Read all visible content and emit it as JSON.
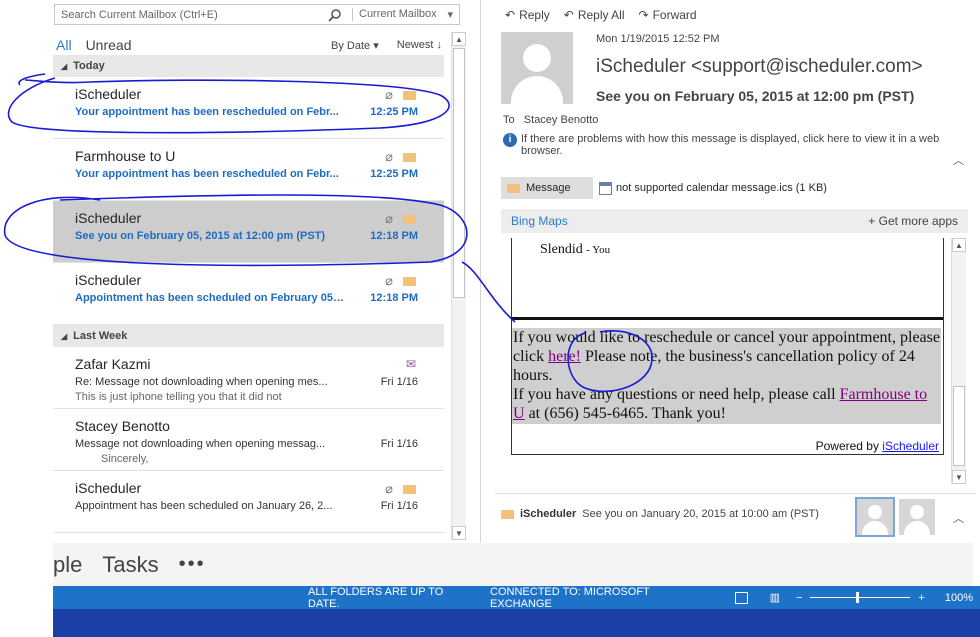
{
  "search": {
    "placeholder": "Search Current Mailbox (Ctrl+E)",
    "scope": "Current Mailbox"
  },
  "filters": {
    "all": "All",
    "unread": "Unread",
    "sort_by": "By Date",
    "order": "Newest"
  },
  "groups": [
    {
      "label": "Today"
    },
    {
      "label": "Last Week"
    }
  ],
  "messages": [
    {
      "from": "iScheduler",
      "subject": "Your appointment has been rescheduled on Febr...",
      "time": "12:25 PM",
      "preview": "",
      "unread": true
    },
    {
      "from": "Farmhouse to U",
      "subject": "Your appointment has been rescheduled on Febr...",
      "time": "12:25 PM",
      "preview": "",
      "unread": true
    },
    {
      "from": "iScheduler",
      "subject": "See you on February 05, 2015  at 12:00 pm (PST)",
      "time": "12:18 PM",
      "preview": "",
      "unread": true
    },
    {
      "from": "iScheduler",
      "subject": "Appointment has been scheduled on February 05,...",
      "time": "12:18 PM",
      "preview": "",
      "unread": true
    },
    {
      "from": "Zafar Kazmi",
      "subject": "Re: Message not downloading when opening mes...",
      "time": "Fri 1/16",
      "preview": "This is just iphone telling you that it did not",
      "unread": false
    },
    {
      "from": "Stacey Benotto",
      "subject": "Message not downloading when opening messag...",
      "time": "Fri 1/16",
      "preview": "Sincerely,",
      "unread": false
    },
    {
      "from": "iScheduler",
      "subject": "Appointment has been scheduled on January 26, 2...",
      "time": "Fri 1/16",
      "preview": "",
      "unread": false
    }
  ],
  "reading": {
    "actions": {
      "reply": "Reply",
      "reply_all": "Reply All",
      "forward": "Forward"
    },
    "date": "Mon 1/19/2015 12:52 PM",
    "from": "iScheduler <support@ischeduler.com>",
    "subject": "See you on February 05, 2015  at 12:00 pm (PST)",
    "to_label": "To",
    "to": "Stacey Benotto",
    "info": "If there are problems with how this message is displayed, click here to view it in a web browser.",
    "message_tab": "Message",
    "attachment": "not supported calendar message.ics (1 KB)",
    "bing_maps": "Bing Maps",
    "get_more_apps": "Get more apps",
    "body": {
      "slendid": "Slendid",
      "slendid_suffix": "- You",
      "para1_a": "If you would like to reschedule or cancel your appointment, please click ",
      "para1_link": "here!",
      "para1_b": " Please note, the business's cancellation policy of 24 hours.",
      "para2_a": "If you have any questions or need help, please call ",
      "para2_link": "Farmhouse to U",
      "para2_b": " at (656) 545-6465. Thank you!",
      "powered_by": "Powered by ",
      "powered_link": "iScheduler"
    },
    "conversation": {
      "from": "iScheduler",
      "subject": "See you on January 20, 2015  at 10:00 am (PST)"
    }
  },
  "nav": {
    "item1": "ple",
    "item2": "Tasks",
    "more": "•••"
  },
  "status": {
    "folders": "ALL FOLDERS ARE UP TO DATE.",
    "connection": "CONNECTED TO: MICROSOFT EXCHANGE",
    "zoom": "100%"
  },
  "colors": {
    "accent": "#1e72c8",
    "unread": "#1e6cc2",
    "ink": "#1a1ad6"
  }
}
